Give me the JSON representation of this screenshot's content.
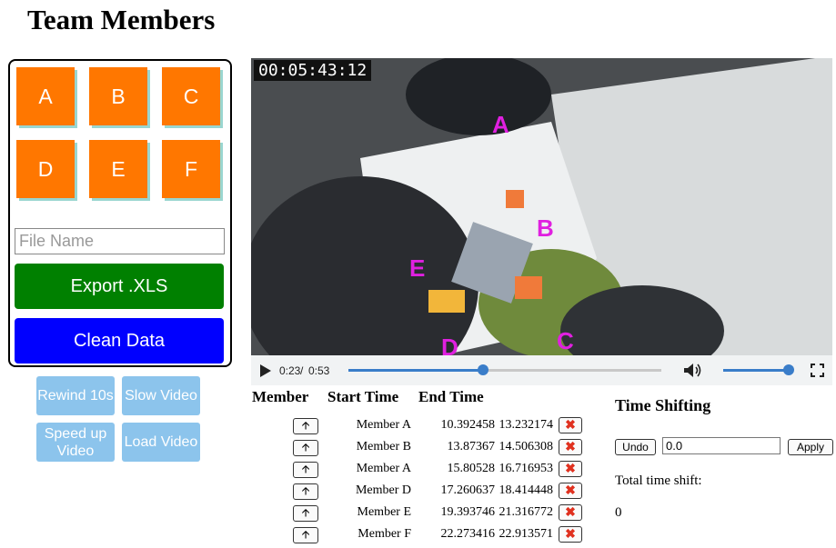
{
  "page_title": "Team Members",
  "members": [
    "A",
    "B",
    "C",
    "D",
    "E",
    "F"
  ],
  "file_name": {
    "placeholder": "File Name",
    "value": ""
  },
  "export_label": "Export .XLS",
  "clean_label": "Clean Data",
  "extra_buttons": {
    "rewind": "Rewind 10s",
    "slow": "Slow Video",
    "speed": "Speed up Video",
    "load": "Load Video"
  },
  "video": {
    "timecode": "00:05:43:12",
    "labels": [
      "A",
      "B",
      "C",
      "D",
      "E"
    ],
    "current_time": "0:23",
    "duration": "0:53",
    "progress": 0.43,
    "volume": 1.0
  },
  "table": {
    "headers": [
      "Member",
      "Start Time",
      "End Time"
    ],
    "rows": [
      {
        "member": "Member A",
        "start": "10.392458",
        "end": "13.232174"
      },
      {
        "member": "Member B",
        "start": "13.87367",
        "end": "14.506308"
      },
      {
        "member": "Member A",
        "start": "15.80528",
        "end": "16.716953"
      },
      {
        "member": "Member D",
        "start": "17.260637",
        "end": "18.414448"
      },
      {
        "member": "Member E",
        "start": "19.393746",
        "end": "21.316772"
      },
      {
        "member": "Member F",
        "start": "22.273416",
        "end": "22.913571"
      }
    ]
  },
  "time_shift": {
    "title": "Time Shifting",
    "undo_label": "Undo",
    "input_value": "0.0",
    "apply_label": "Apply",
    "total_label": "Total time shift:",
    "total_value": "0"
  },
  "colors": {
    "member_button": "#ff7700",
    "export_button": "#008000",
    "clean_button": "#0000ff",
    "small_button": "#8cc4ec",
    "video_label": "#e020e0",
    "delete_icon": "#e0301e"
  }
}
